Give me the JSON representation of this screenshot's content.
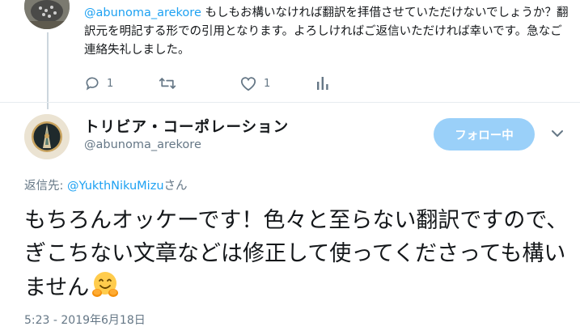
{
  "prev_reply": {
    "mention": "@abunoma_arekore",
    "text": " もしもお構いなければ翻訳を拝借させていただけないでしょうか？翻訳元を明記する形での引用となります。よろしければご返信いただければ幸いです。急なご連絡失礼しました。",
    "actions": {
      "reply_count": "1",
      "retweet_count": "",
      "like_count": "1"
    },
    "icons": [
      "reply-icon",
      "retweet-icon",
      "like-icon",
      "analytics-icon"
    ]
  },
  "tweet": {
    "author": {
      "display_name": "トリビア・コーポレーション",
      "handle": "@abunoma_arekore"
    },
    "follow_label": "フォロー中",
    "replying_prefix": "返信先: ",
    "replying_to": "@YukthNikuMizu",
    "replying_suffix": "さん",
    "text": "もちろんオッケーです！色々と至らない翻訳ですので、ぎこちない文章などは修正して使ってくださっても構いません",
    "emoji": "hugging-face",
    "timestamp": "5:23 - 2019年6月18日"
  },
  "colors": {
    "accent": "#1da1f2",
    "follow_bg": "#9ad0f9",
    "muted": "#657786"
  }
}
